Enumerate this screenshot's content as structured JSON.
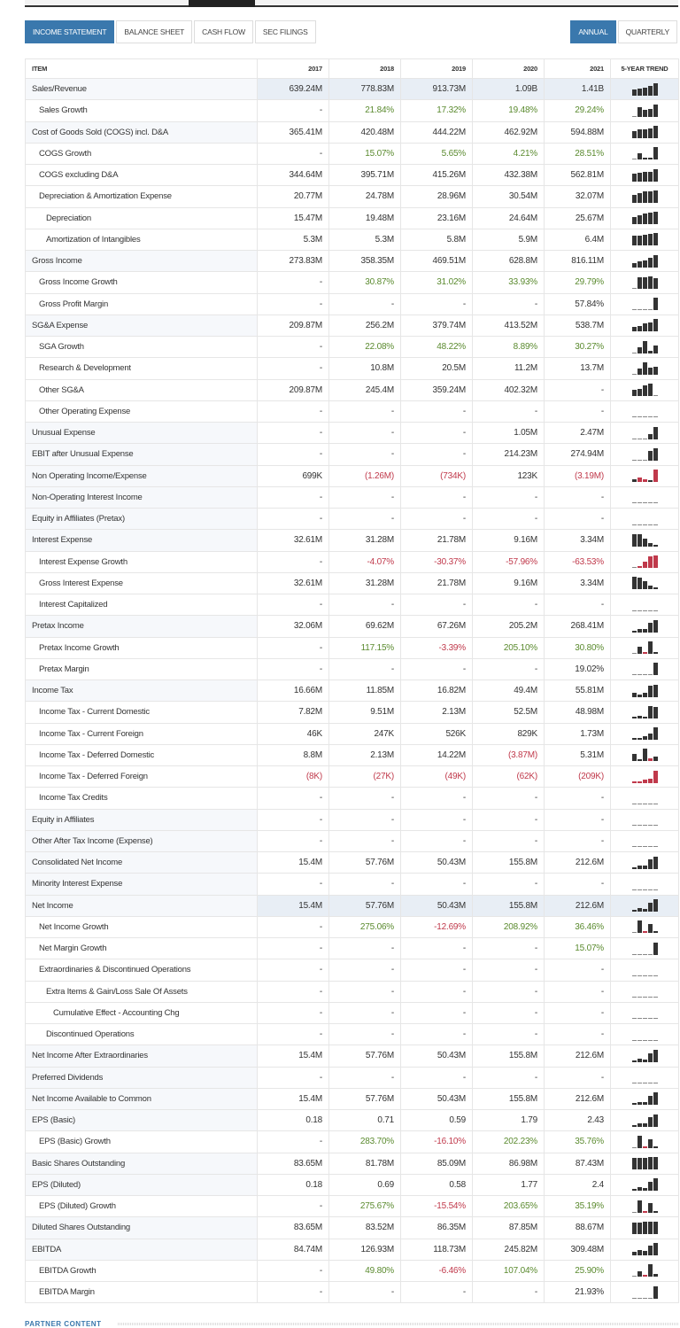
{
  "tabs": [
    {
      "label": "INCOME STATEMENT",
      "active": true
    },
    {
      "label": "BALANCE SHEET"
    },
    {
      "label": "CASH FLOW"
    },
    {
      "label": "SEC FILINGS"
    }
  ],
  "period": [
    {
      "label": "ANNUAL",
      "active": true
    },
    {
      "label": "QUARTERLY"
    }
  ],
  "colors": {
    "accent": "#3a78ad",
    "positive": "#5a8a2e",
    "negative": "#c0394b"
  },
  "table": {
    "headers": [
      "ITEM",
      "2017",
      "2018",
      "2019",
      "2020",
      "2021",
      "5-YEAR TREND"
    ],
    "rows": [
      {
        "label": "Sales/Revenue",
        "indent": 0,
        "highlight": true,
        "values": [
          "639.24M",
          "778.83M",
          "913.73M",
          "1.09B",
          "1.41B"
        ]
      },
      {
        "label": "Sales Growth",
        "indent": 1,
        "values": [
          "-",
          "21.84%",
          "17.32%",
          "19.48%",
          "29.24%"
        ]
      },
      {
        "label": "Cost of Goods Sold (COGS) incl. D&A",
        "indent": 0,
        "values": [
          "365.41M",
          "420.48M",
          "444.22M",
          "462.92M",
          "594.88M"
        ]
      },
      {
        "label": "COGS Growth",
        "indent": 1,
        "values": [
          "-",
          "15.07%",
          "5.65%",
          "4.21%",
          "28.51%"
        ]
      },
      {
        "label": "COGS excluding D&A",
        "indent": 1,
        "values": [
          "344.64M",
          "395.71M",
          "415.26M",
          "432.38M",
          "562.81M"
        ]
      },
      {
        "label": "Depreciation & Amortization Expense",
        "indent": 1,
        "values": [
          "20.77M",
          "24.78M",
          "28.96M",
          "30.54M",
          "32.07M"
        ]
      },
      {
        "label": "Depreciation",
        "indent": 2,
        "values": [
          "15.47M",
          "19.48M",
          "23.16M",
          "24.64M",
          "25.67M"
        ]
      },
      {
        "label": "Amortization of Intangibles",
        "indent": 2,
        "values": [
          "5.3M",
          "5.3M",
          "5.8M",
          "5.9M",
          "6.4M"
        ]
      },
      {
        "label": "Gross Income",
        "indent": 0,
        "values": [
          "273.83M",
          "358.35M",
          "469.51M",
          "628.8M",
          "816.11M"
        ]
      },
      {
        "label": "Gross Income Growth",
        "indent": 1,
        "values": [
          "-",
          "30.87%",
          "31.02%",
          "33.93%",
          "29.79%"
        ]
      },
      {
        "label": "Gross Profit Margin",
        "indent": 1,
        "values": [
          "-",
          "-",
          "-",
          "-",
          "57.84%"
        ]
      },
      {
        "label": "SG&A Expense",
        "indent": 0,
        "values": [
          "209.87M",
          "256.2M",
          "379.74M",
          "413.52M",
          "538.7M"
        ]
      },
      {
        "label": "SGA Growth",
        "indent": 1,
        "values": [
          "-",
          "22.08%",
          "48.22%",
          "8.89%",
          "30.27%"
        ]
      },
      {
        "label": "Research & Development",
        "indent": 1,
        "values": [
          "-",
          "10.8M",
          "20.5M",
          "11.2M",
          "13.7M"
        ]
      },
      {
        "label": "Other SG&A",
        "indent": 1,
        "values": [
          "209.87M",
          "245.4M",
          "359.24M",
          "402.32M",
          "-"
        ]
      },
      {
        "label": "Other Operating Expense",
        "indent": 1,
        "values": [
          "-",
          "-",
          "-",
          "-",
          "-"
        ]
      },
      {
        "label": "Unusual Expense",
        "indent": 0,
        "values": [
          "-",
          "-",
          "-",
          "1.05M",
          "2.47M"
        ]
      },
      {
        "label": "EBIT after Unusual Expense",
        "indent": 0,
        "values": [
          "-",
          "-",
          "-",
          "214.23M",
          "274.94M"
        ]
      },
      {
        "label": "Non Operating Income/Expense",
        "indent": 0,
        "values": [
          "699K",
          "(1.26M)",
          "(734K)",
          "123K",
          "(3.19M)"
        ]
      },
      {
        "label": "Non-Operating Interest Income",
        "indent": 0,
        "values": [
          "-",
          "-",
          "-",
          "-",
          "-"
        ]
      },
      {
        "label": "Equity in Affiliates (Pretax)",
        "indent": 0,
        "values": [
          "-",
          "-",
          "-",
          "-",
          "-"
        ]
      },
      {
        "label": "Interest Expense",
        "indent": 0,
        "values": [
          "32.61M",
          "31.28M",
          "21.78M",
          "9.16M",
          "3.34M"
        ]
      },
      {
        "label": "Interest Expense Growth",
        "indent": 1,
        "values": [
          "-",
          "-4.07%",
          "-30.37%",
          "-57.96%",
          "-63.53%"
        ]
      },
      {
        "label": "Gross Interest Expense",
        "indent": 1,
        "values": [
          "32.61M",
          "31.28M",
          "21.78M",
          "9.16M",
          "3.34M"
        ]
      },
      {
        "label": "Interest Capitalized",
        "indent": 1,
        "values": [
          "-",
          "-",
          "-",
          "-",
          "-"
        ]
      },
      {
        "label": "Pretax Income",
        "indent": 0,
        "values": [
          "32.06M",
          "69.62M",
          "67.26M",
          "205.2M",
          "268.41M"
        ]
      },
      {
        "label": "Pretax Income Growth",
        "indent": 1,
        "values": [
          "-",
          "117.15%",
          "-3.39%",
          "205.10%",
          "30.80%"
        ]
      },
      {
        "label": "Pretax Margin",
        "indent": 1,
        "values": [
          "-",
          "-",
          "-",
          "-",
          "19.02%"
        ]
      },
      {
        "label": "Income Tax",
        "indent": 0,
        "values": [
          "16.66M",
          "11.85M",
          "16.82M",
          "49.4M",
          "55.81M"
        ]
      },
      {
        "label": "Income Tax - Current Domestic",
        "indent": 1,
        "values": [
          "7.82M",
          "9.51M",
          "2.13M",
          "52.5M",
          "48.98M"
        ]
      },
      {
        "label": "Income Tax - Current Foreign",
        "indent": 1,
        "values": [
          "46K",
          "247K",
          "526K",
          "829K",
          "1.73M"
        ]
      },
      {
        "label": "Income Tax - Deferred Domestic",
        "indent": 1,
        "values": [
          "8.8M",
          "2.13M",
          "14.22M",
          "(3.87M)",
          "5.31M"
        ]
      },
      {
        "label": "Income Tax - Deferred Foreign",
        "indent": 1,
        "values": [
          "(8K)",
          "(27K)",
          "(49K)",
          "(62K)",
          "(209K)"
        ]
      },
      {
        "label": "Income Tax Credits",
        "indent": 1,
        "values": [
          "-",
          "-",
          "-",
          "-",
          "-"
        ]
      },
      {
        "label": "Equity in Affiliates",
        "indent": 0,
        "values": [
          "-",
          "-",
          "-",
          "-",
          "-"
        ]
      },
      {
        "label": "Other After Tax Income (Expense)",
        "indent": 0,
        "values": [
          "-",
          "-",
          "-",
          "-",
          "-"
        ]
      },
      {
        "label": "Consolidated Net Income",
        "indent": 0,
        "values": [
          "15.4M",
          "57.76M",
          "50.43M",
          "155.8M",
          "212.6M"
        ]
      },
      {
        "label": "Minority Interest Expense",
        "indent": 0,
        "values": [
          "-",
          "-",
          "-",
          "-",
          "-"
        ]
      },
      {
        "label": "Net Income",
        "indent": 0,
        "highlight": true,
        "values": [
          "15.4M",
          "57.76M",
          "50.43M",
          "155.8M",
          "212.6M"
        ]
      },
      {
        "label": "Net Income Growth",
        "indent": 1,
        "values": [
          "-",
          "275.06%",
          "-12.69%",
          "208.92%",
          "36.46%"
        ]
      },
      {
        "label": "Net Margin Growth",
        "indent": 1,
        "values": [
          "-",
          "-",
          "-",
          "-",
          "15.07%"
        ]
      },
      {
        "label": "Extraordinaries & Discontinued Operations",
        "indent": 1,
        "values": [
          "-",
          "-",
          "-",
          "-",
          "-"
        ]
      },
      {
        "label": "Extra Items & Gain/Loss Sale Of Assets",
        "indent": 2,
        "values": [
          "-",
          "-",
          "-",
          "-",
          "-"
        ]
      },
      {
        "label": "Cumulative Effect - Accounting Chg",
        "indent": 3,
        "values": [
          "-",
          "-",
          "-",
          "-",
          "-"
        ]
      },
      {
        "label": "Discontinued Operations",
        "indent": 2,
        "values": [
          "-",
          "-",
          "-",
          "-",
          "-"
        ]
      },
      {
        "label": "Net Income After Extraordinaries",
        "indent": 0,
        "values": [
          "15.4M",
          "57.76M",
          "50.43M",
          "155.8M",
          "212.6M"
        ]
      },
      {
        "label": "Preferred Dividends",
        "indent": 0,
        "values": [
          "-",
          "-",
          "-",
          "-",
          "-"
        ]
      },
      {
        "label": "Net Income Available to Common",
        "indent": 0,
        "values": [
          "15.4M",
          "57.76M",
          "50.43M",
          "155.8M",
          "212.6M"
        ]
      },
      {
        "label": "EPS (Basic)",
        "indent": 0,
        "values": [
          "0.18",
          "0.71",
          "0.59",
          "1.79",
          "2.43"
        ]
      },
      {
        "label": "EPS (Basic) Growth",
        "indent": 1,
        "values": [
          "-",
          "283.70%",
          "-16.10%",
          "202.23%",
          "35.76%"
        ]
      },
      {
        "label": "Basic Shares Outstanding",
        "indent": 0,
        "values": [
          "83.65M",
          "81.78M",
          "85.09M",
          "86.98M",
          "87.43M"
        ]
      },
      {
        "label": "EPS (Diluted)",
        "indent": 0,
        "values": [
          "0.18",
          "0.69",
          "0.58",
          "1.77",
          "2.4"
        ]
      },
      {
        "label": "EPS (Diluted) Growth",
        "indent": 1,
        "values": [
          "-",
          "275.67%",
          "-15.54%",
          "203.65%",
          "35.19%"
        ]
      },
      {
        "label": "Diluted Shares Outstanding",
        "indent": 0,
        "values": [
          "83.65M",
          "83.52M",
          "86.35M",
          "87.85M",
          "88.67M"
        ]
      },
      {
        "label": "EBITDA",
        "indent": 0,
        "values": [
          "84.74M",
          "126.93M",
          "118.73M",
          "245.82M",
          "309.48M"
        ]
      },
      {
        "label": "EBITDA Growth",
        "indent": 1,
        "values": [
          "-",
          "49.80%",
          "-6.46%",
          "107.04%",
          "25.90%"
        ]
      },
      {
        "label": "EBITDA Margin",
        "indent": 1,
        "values": [
          "-",
          "-",
          "-",
          "-",
          "21.93%"
        ]
      }
    ]
  },
  "partner": {
    "label": "PARTNER CONTENT"
  }
}
